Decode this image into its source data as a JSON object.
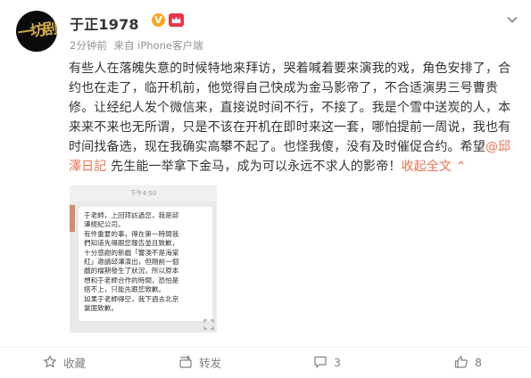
{
  "user": {
    "name": "于正1978",
    "verified_badge": "V",
    "avatar_text": "一坊剧"
  },
  "meta": {
    "time": "2分钟前",
    "source": "来自 iPhone客户端"
  },
  "post": {
    "lines": [
      "有些人在落魄失意的时候特地来拜访，哭着喊着要来演我的戏，角色安排了，合",
      "约也在走了，临开机前，他觉得自己快成为金马影帝了，不合适演男三号曹贵",
      "修。让经纪人发个微信来，直接说时间不行，不接了。我是个雪中送炭的人，本",
      "来来不来也无所谓，只是不该在开机在即时来这一套，哪怕提前一周说，我也有",
      "时间找备选，现在我确实高攀不起了。也怪我傻，没有及时催促合约。希望"
    ],
    "mention_line_start": "@邱",
    "mention_line2_mention": "澤日記",
    "line6_text": " 先生能一举拿下金马，成为可以永远不求人的影帝！",
    "more_label": "收起全文",
    "more_arrow": "⌃"
  },
  "thumbnail": {
    "top_time": "下午4:50",
    "message_lines": [
      "于老師，上回拜訪過您，我是邱",
      "澤經紀公司。",
      "有件重要的事，得在第一時間我",
      "們知道先得跟您報告並且致歉，",
      "十分感謝的新戲「響澳不是海棠",
      "紅」邀請邱澤演出，但剛前一個",
      "戲的檔期發生了狀況，所以原本",
      "想和于老師合作的時間，恐怕是",
      "搭不上，只能先跟您致歉。",
      "如果于老師得空，我下週去北京",
      "當面致歉。"
    ]
  },
  "actions": {
    "favorite_label": "收藏",
    "forward_label": "转发",
    "comment_count": "3",
    "like_count": "8"
  },
  "colors": {
    "accent": "#eb7350",
    "meta_gray": "#939393",
    "badge_orange": "#f6a623",
    "crown_red": "#e8364a"
  }
}
